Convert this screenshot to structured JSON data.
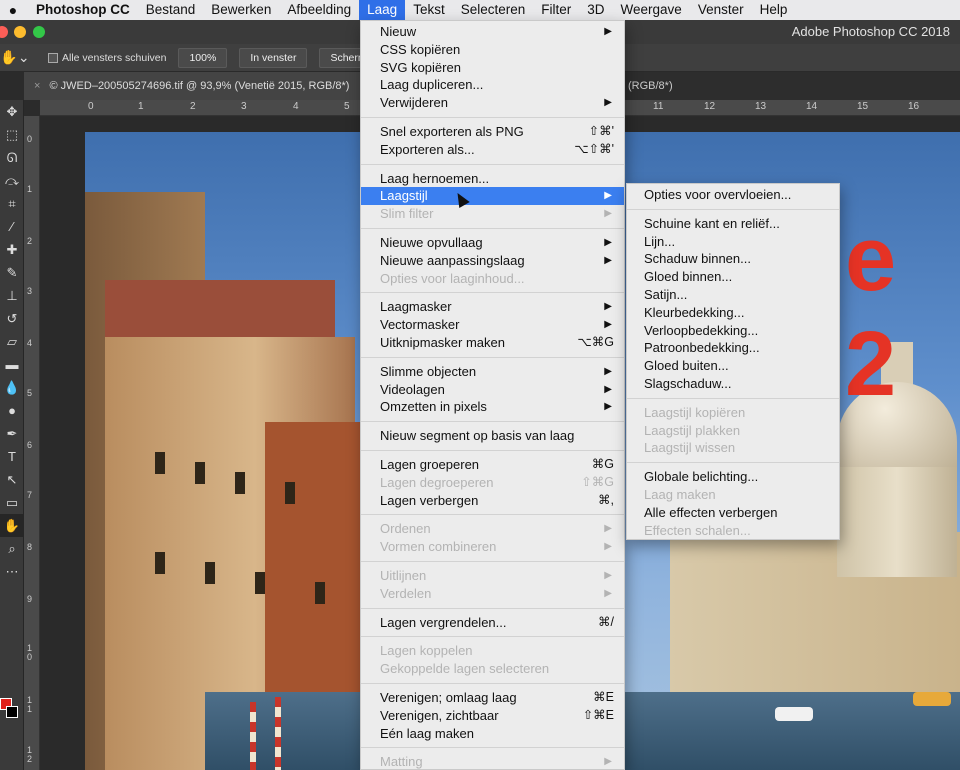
{
  "menubar": {
    "app": "Photoshop CC",
    "items": [
      "Bestand",
      "Bewerken",
      "Afbeelding",
      "Laag",
      "Tekst",
      "Selecteren",
      "Filter",
      "3D",
      "Weergave",
      "Venster",
      "Help"
    ],
    "active": "Laag"
  },
  "titlebar": {
    "title": "Adobe Photoshop CC 2018"
  },
  "optionsbar": {
    "check_label": "Alle vensters schuiven",
    "zoom": "100%",
    "fit_button": "In venster",
    "fill_button": "Scherm o"
  },
  "tab": {
    "close": "×",
    "title": "© JWED–200505274696.tif @ 93,9% (Venetië 2015, RGB/8*)",
    "mode": "(RGB/8*)"
  },
  "ruler_h": [
    "0",
    "1",
    "2",
    "3",
    "4",
    "5",
    "11",
    "12",
    "13",
    "14",
    "15",
    "16"
  ],
  "ruler_v": [
    "0",
    "1",
    "2",
    "3",
    "4",
    "5",
    "6",
    "7",
    "8",
    "9",
    "1\n0",
    "1\n1",
    "1\n2"
  ],
  "canvas_text": "e 2",
  "colors": {
    "foreground": "#e0211b",
    "background": "#000000",
    "highlight": "#3b7ff0"
  },
  "layer_menu": [
    {
      "label": "Nieuw",
      "arrow": true
    },
    {
      "label": "CSS kopiëren"
    },
    {
      "label": "SVG kopiëren"
    },
    {
      "label": "Laag dupliceren..."
    },
    {
      "label": "Verwijderen",
      "arrow": true
    },
    {
      "sep": true
    },
    {
      "label": "Snel exporteren als PNG",
      "shortcut": "⇧⌘'"
    },
    {
      "label": "Exporteren als...",
      "shortcut": "⌥⇧⌘'"
    },
    {
      "sep": true
    },
    {
      "label": "Laag hernoemen..."
    },
    {
      "label": "Laagstijl",
      "arrow": true,
      "highlight": true
    },
    {
      "label": "Slim filter",
      "arrow": true,
      "disabled": true
    },
    {
      "sep": true
    },
    {
      "label": "Nieuwe opvullaag",
      "arrow": true
    },
    {
      "label": "Nieuwe aanpassingslaag",
      "arrow": true
    },
    {
      "label": "Opties voor laaginhoud...",
      "disabled": true
    },
    {
      "sep": true
    },
    {
      "label": "Laagmasker",
      "arrow": true
    },
    {
      "label": "Vectormasker",
      "arrow": true
    },
    {
      "label": "Uitknipmasker maken",
      "shortcut": "⌥⌘G"
    },
    {
      "sep": true
    },
    {
      "label": "Slimme objecten",
      "arrow": true
    },
    {
      "label": "Videolagen",
      "arrow": true
    },
    {
      "label": "Omzetten in pixels",
      "arrow": true
    },
    {
      "sep": true
    },
    {
      "label": "Nieuw segment op basis van laag"
    },
    {
      "sep": true
    },
    {
      "label": "Lagen groeperen",
      "shortcut": "⌘G"
    },
    {
      "label": "Lagen degroeperen",
      "shortcut": "⇧⌘G",
      "disabled": true
    },
    {
      "label": "Lagen verbergen",
      "shortcut": "⌘,"
    },
    {
      "sep": true
    },
    {
      "label": "Ordenen",
      "arrow": true,
      "disabled": true
    },
    {
      "label": "Vormen combineren",
      "arrow": true,
      "disabled": true
    },
    {
      "sep": true
    },
    {
      "label": "Uitlijnen",
      "arrow": true,
      "disabled": true
    },
    {
      "label": "Verdelen",
      "arrow": true,
      "disabled": true
    },
    {
      "sep": true
    },
    {
      "label": "Lagen vergrendelen...",
      "shortcut": "⌘/"
    },
    {
      "sep": true
    },
    {
      "label": "Lagen koppelen",
      "disabled": true
    },
    {
      "label": "Gekoppelde lagen selecteren",
      "disabled": true
    },
    {
      "sep": true
    },
    {
      "label": "Verenigen; omlaag laag",
      "shortcut": "⌘E"
    },
    {
      "label": "Verenigen, zichtbaar",
      "shortcut": "⇧⌘E"
    },
    {
      "label": "Eén laag maken"
    },
    {
      "sep": true
    },
    {
      "label": "Matting",
      "arrow": true,
      "disabled": true
    }
  ],
  "layer_style_submenu": [
    {
      "label": "Opties voor overvloeien..."
    },
    {
      "sep": true
    },
    {
      "label": "Schuine kant en reliëf..."
    },
    {
      "label": "Lijn..."
    },
    {
      "label": "Schaduw binnen..."
    },
    {
      "label": "Gloed binnen..."
    },
    {
      "label": "Satijn..."
    },
    {
      "label": "Kleurbedekking..."
    },
    {
      "label": "Verloopbedekking..."
    },
    {
      "label": "Patroonbedekking..."
    },
    {
      "label": "Gloed buiten..."
    },
    {
      "label": "Slagschaduw..."
    },
    {
      "sep": true
    },
    {
      "label": "Laagstijl kopiëren",
      "disabled": true
    },
    {
      "label": "Laagstijl plakken",
      "disabled": true
    },
    {
      "label": "Laagstijl wissen",
      "disabled": true
    },
    {
      "sep": true
    },
    {
      "label": "Globale belichting..."
    },
    {
      "label": "Laag maken",
      "disabled": true
    },
    {
      "label": "Alle effecten verbergen"
    },
    {
      "label": "Effecten schalen...",
      "disabled": true
    }
  ]
}
